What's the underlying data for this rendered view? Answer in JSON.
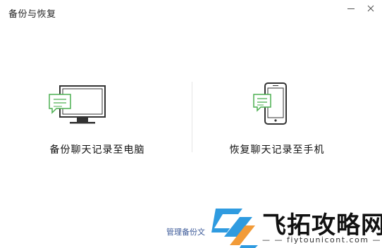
{
  "window": {
    "title": "备份与恢复"
  },
  "options": {
    "backup_to_pc": {
      "label": "备份聊天记录至电脑"
    },
    "restore_to_phone": {
      "label": "恢复聊天记录至手机"
    }
  },
  "footer": {
    "manage_backup_label": "管理备份文"
  },
  "watermark": {
    "name": "飞拓攻略网",
    "url": "— — fiytounicont.com — —"
  },
  "colors": {
    "bubble_green": "#4caf50",
    "link_blue": "#3b5998",
    "logo_blue": "#2f9be0",
    "logo_orange": "#f29b38"
  }
}
